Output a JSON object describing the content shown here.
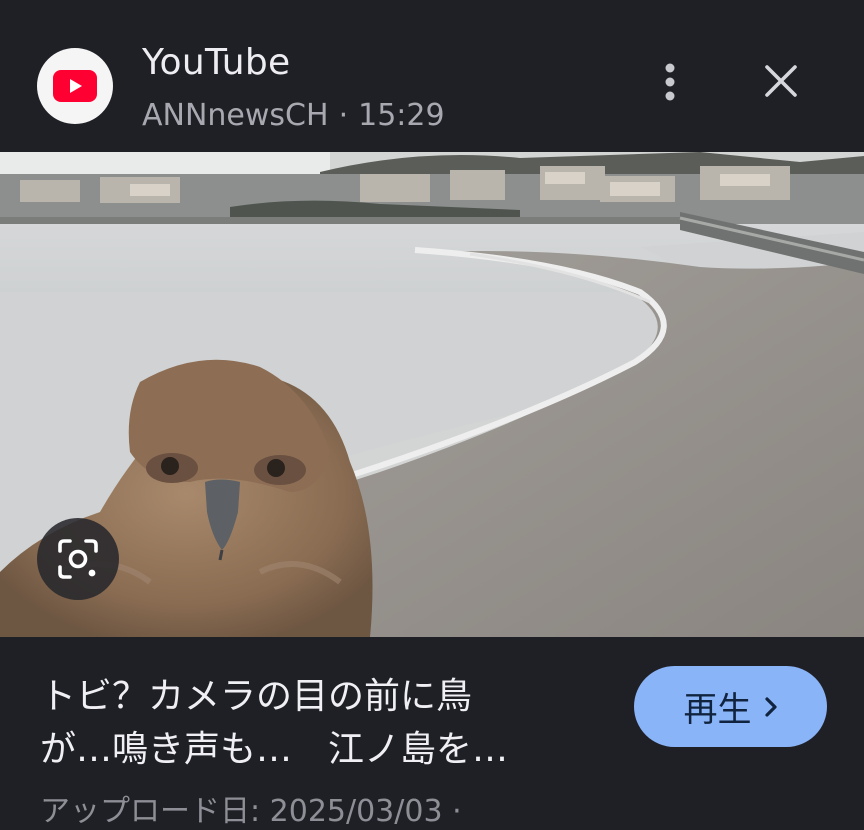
{
  "header": {
    "app_name": "YouTube",
    "channel": "ANNnewsCH",
    "separator": "·",
    "duration": "15:29"
  },
  "icons": {
    "app": "youtube-logo-icon",
    "menu": "more-vert-icon",
    "close": "close-icon",
    "lens": "google-lens-icon",
    "chevron": "chevron-right-icon"
  },
  "video": {
    "title": "トビ？カメラの目の前に鳥\nが…鳴き声も…　江ノ島を…",
    "play_label": "再生",
    "upload_info": "アップロード日: 2025/03/03 ·"
  },
  "colors": {
    "background": "#1f2026",
    "accent_button": "#8ab4f8",
    "youtube_red": "#ff0033"
  }
}
